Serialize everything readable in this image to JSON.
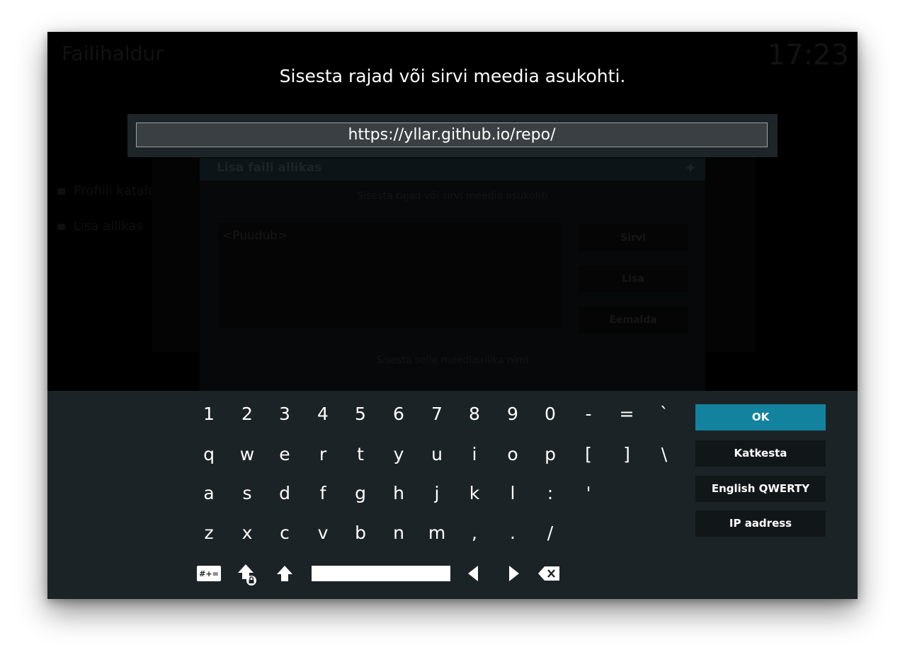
{
  "background": {
    "title": "Failihaldur",
    "clock": "17:23",
    "sidebar": [
      "Profiili kataloog",
      "Lisa allikas"
    ],
    "dialog": {
      "title": "Lisa faili allikas",
      "subtitle": "Sisesta rajad või sirvi meedia asukohti",
      "list_placeholder": "<Puudub>",
      "buttons": [
        "Sirvi",
        "Lisa",
        "Eemalda"
      ],
      "name_hint": "Sisesta selle meediaallika nimi"
    }
  },
  "keyboard_dialog": {
    "heading": "Sisesta rajad või sirvi meedia asukohti.",
    "input_value": "https://yllar.github.io/repo/"
  },
  "keys": {
    "row1": [
      "1",
      "2",
      "3",
      "4",
      "5",
      "6",
      "7",
      "8",
      "9",
      "0",
      "-",
      "=",
      "`"
    ],
    "row2": [
      "q",
      "w",
      "e",
      "r",
      "t",
      "y",
      "u",
      "i",
      "o",
      "p",
      "[",
      "]",
      "\\"
    ],
    "row3": [
      "a",
      "s",
      "d",
      "f",
      "g",
      "h",
      "j",
      "k",
      "l",
      ":",
      "'"
    ],
    "row4": [
      "z",
      "x",
      "c",
      "v",
      "b",
      "n",
      "m",
      ",",
      ".",
      "/"
    ]
  },
  "toolbar": {
    "symbols_label": "#+="
  },
  "side_buttons": {
    "ok": "OK",
    "cancel": "Katkesta",
    "layout": "English QWERTY",
    "ip": "IP aadress"
  },
  "colors": {
    "accent": "#12829f",
    "keyboard_bg": "#1c2326",
    "button_bg": "#111618"
  }
}
